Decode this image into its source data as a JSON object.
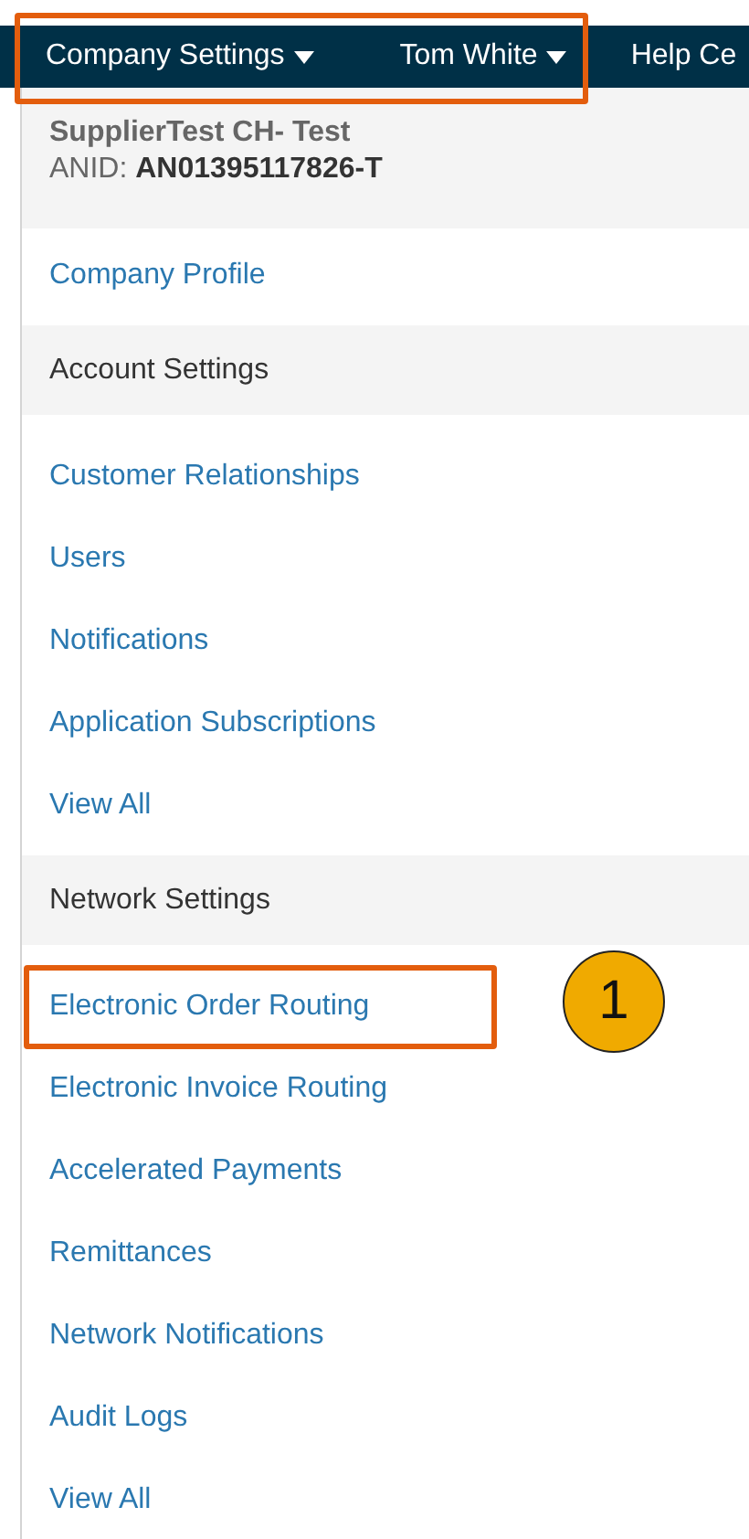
{
  "nav": {
    "items": [
      {
        "label": "Company Settings",
        "dropdown": true,
        "highlighted": true
      },
      {
        "label": "Tom White",
        "dropdown": true,
        "highlighted": true
      },
      {
        "label": "Help Ce",
        "dropdown": false,
        "highlighted": false
      }
    ]
  },
  "account": {
    "name": "SupplierTest CH- Test",
    "id_label": "ANID:",
    "id_value": "AN01395117826-T"
  },
  "menu": [
    {
      "kind": "link",
      "label": "Company Profile",
      "highlighted": false
    },
    {
      "kind": "section",
      "label": "Account Settings",
      "highlighted": false
    },
    {
      "kind": "link",
      "label": "Customer Relationships",
      "highlighted": false
    },
    {
      "kind": "link",
      "label": "Users",
      "highlighted": false
    },
    {
      "kind": "link",
      "label": "Notifications",
      "highlighted": false
    },
    {
      "kind": "link",
      "label": "Application Subscriptions",
      "highlighted": false
    },
    {
      "kind": "link",
      "label": "View All",
      "highlighted": false
    },
    {
      "kind": "section",
      "label": "Network Settings",
      "highlighted": false
    },
    {
      "kind": "link",
      "label": "Electronic Order Routing",
      "highlighted": true,
      "callout": "1"
    },
    {
      "kind": "link",
      "label": "Electronic Invoice Routing",
      "highlighted": false
    },
    {
      "kind": "link",
      "label": "Accelerated Payments",
      "highlighted": false
    },
    {
      "kind": "link",
      "label": "Remittances",
      "highlighted": false
    },
    {
      "kind": "link",
      "label": "Network Notifications",
      "highlighted": false
    },
    {
      "kind": "link",
      "label": "Audit Logs",
      "highlighted": false
    },
    {
      "kind": "link",
      "label": "View All",
      "highlighted": false
    }
  ]
}
